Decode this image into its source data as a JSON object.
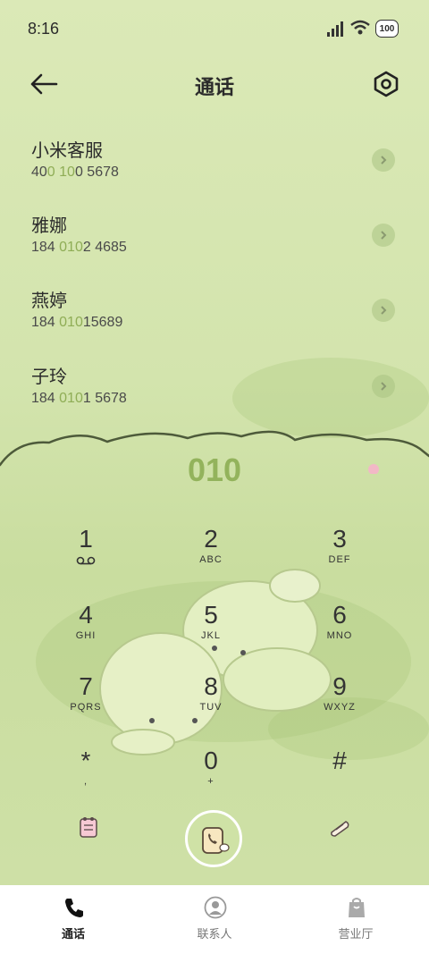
{
  "status_bar": {
    "time": "8:16",
    "battery": "100"
  },
  "header": {
    "title": "通话"
  },
  "contacts": [
    {
      "name": "小米客服",
      "number_parts": [
        "40",
        "0",
        " ",
        "10",
        "0 5678"
      ]
    },
    {
      "name": "雅娜",
      "number_parts": [
        "184 ",
        "010",
        "2 4685",
        "",
        ""
      ]
    },
    {
      "name": "燕婷",
      "number_parts": [
        "184 ",
        "010",
        "15689",
        "",
        ""
      ]
    },
    {
      "name": "子玲",
      "number_parts": [
        "184 ",
        "010",
        "1 5678",
        "",
        ""
      ]
    }
  ],
  "dialpad": {
    "display": "010",
    "keys": [
      {
        "digit": "1",
        "letters": ""
      },
      {
        "digit": "2",
        "letters": "ABC"
      },
      {
        "digit": "3",
        "letters": "DEF"
      },
      {
        "digit": "4",
        "letters": "GHI"
      },
      {
        "digit": "5",
        "letters": "JKL"
      },
      {
        "digit": "6",
        "letters": "MNO"
      },
      {
        "digit": "7",
        "letters": "PQRS"
      },
      {
        "digit": "8",
        "letters": "TUV"
      },
      {
        "digit": "9",
        "letters": "WXYZ"
      },
      {
        "digit": "*",
        "letters": ","
      },
      {
        "digit": "0",
        "letters": "+"
      },
      {
        "digit": "#",
        "letters": ""
      }
    ]
  },
  "bottom_nav": [
    {
      "label": "通话",
      "icon": "phone-icon",
      "active": true
    },
    {
      "label": "联系人",
      "icon": "contacts-icon",
      "active": false
    },
    {
      "label": "营业厅",
      "icon": "shopping-bag-icon",
      "active": false
    }
  ],
  "colors": {
    "accent": "#93b35c",
    "background": "#d9e8b6"
  }
}
